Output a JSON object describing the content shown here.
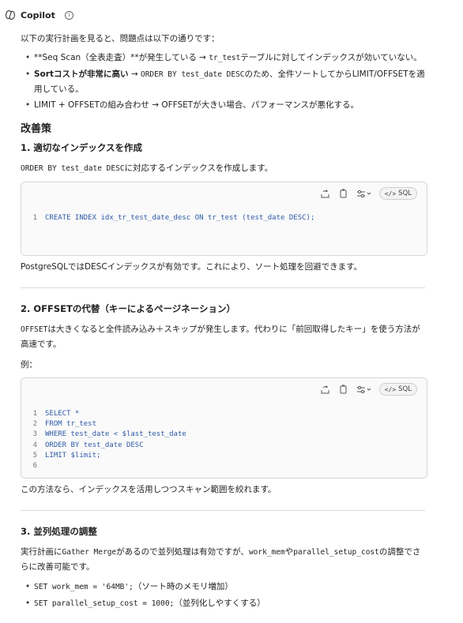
{
  "header": {
    "title": "Copilot",
    "info_icon": "info-icon",
    "logo_icon": "copilot-logo-icon"
  },
  "intro": "以下の実行計画を見ると、問題点は以下の通りです：",
  "issues": [
    {
      "pre": "**Seq Scan（全表走査）**が発生している → ",
      "code": "tr_test",
      "post": "テーブルに対してインデックスが効いていない。"
    },
    {
      "bold": "Sortコストが非常に高い",
      "pre": " → ",
      "code": "ORDER BY test_date DESC",
      "post": "のため、全件ソートしてからLIMIT/OFFSETを適用している。"
    },
    {
      "text": "LIMIT + OFFSETの組み合わせ → OFFSETが大きい場合、パフォーマンスが悪化する。"
    }
  ],
  "section_title": "改善策",
  "s1": {
    "title": "1. 適切なインデックスを作成",
    "desc_code": "ORDER BY test_date DESC",
    "desc_text": "に対応するインデックスを作成します。",
    "lang": "SQL",
    "lines": [
      {
        "n": "1",
        "code": "CREATE INDEX idx_tr_test_date_desc ON tr_test (test_date DESC);"
      }
    ],
    "after": "PostgreSQLではDESCインデックスが有効です。これにより、ソート処理を回避できます。"
  },
  "s2": {
    "title": "2. OFFSETの代替（キーによるページネーション）",
    "desc_code": "OFFSET",
    "desc_text": "は大きくなると全件読み込み＋スキップが発生します。代わりに「前回取得したキー」を使う方法が高速です。",
    "example_label": "例：",
    "lang": "SQL",
    "lines": [
      {
        "n": "1",
        "code": "SELECT *"
      },
      {
        "n": "2",
        "code": "FROM tr_test"
      },
      {
        "n": "3",
        "code": "WHERE test_date < $last_test_date"
      },
      {
        "n": "4",
        "code": "ORDER BY test_date DESC"
      },
      {
        "n": "5",
        "code": "LIMIT $limit;"
      },
      {
        "n": "6",
        "code": ""
      }
    ],
    "after": "この方法なら、インデックスを活用しつつスキャン範囲を絞れます。"
  },
  "s3": {
    "title": "3. 並列処理の調整",
    "desc_a": "実行計画に",
    "code_a": "Gather Merge",
    "desc_b": "があるので並列処理は有効ですが、",
    "code_b": "work_mem",
    "desc_c": "や",
    "code_c": "parallel_setup_cost",
    "desc_d": "の調整でさらに改善可能です。",
    "items": [
      {
        "code": "SET work_mem = '64MB';",
        "text": "（ソート時のメモリ増加）"
      },
      {
        "code": "SET parallel_setup_cost = 1000;",
        "text": "（並列化しやすくする）"
      }
    ]
  }
}
